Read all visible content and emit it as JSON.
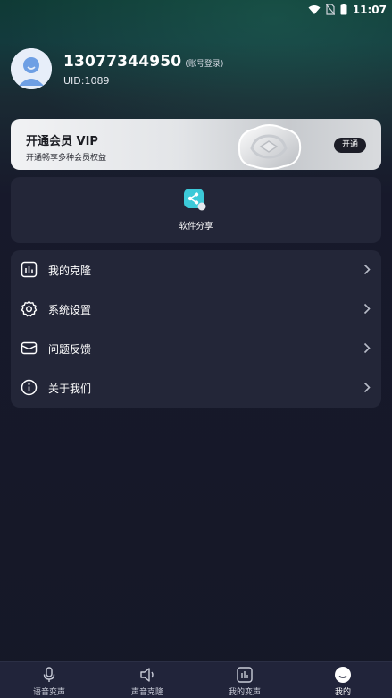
{
  "status_bar": {
    "time": "11:07",
    "icons": [
      "wifi-icon",
      "no-sim-icon",
      "battery-icon"
    ]
  },
  "profile": {
    "phone": "13077344950",
    "login_type": "(账号登录)",
    "uid": "UID:1089"
  },
  "vip": {
    "title": "开通会员 VIP",
    "subtitle": "开通畅享多种会员权益",
    "button": "开通"
  },
  "share": {
    "label": "软件分享",
    "icon": "share-icon"
  },
  "menu": {
    "items": [
      {
        "label": "我的克隆",
        "icon": "chart-icon"
      },
      {
        "label": "系统设置",
        "icon": "gear-icon"
      },
      {
        "label": "问题反馈",
        "icon": "mail-icon"
      },
      {
        "label": "关于我们",
        "icon": "info-icon"
      }
    ]
  },
  "bottom_nav": {
    "items": [
      {
        "label": "语音变声",
        "icon": "microphone-icon"
      },
      {
        "label": "声音克隆",
        "icon": "speaker-icon"
      },
      {
        "label": "我的变声",
        "icon": "equalizer-icon"
      },
      {
        "label": "我的",
        "icon": "profile-icon"
      }
    ],
    "active_index": 3
  },
  "colors": {
    "background": "#171a2b",
    "card": "#232638",
    "accent": "#3cc9d8"
  }
}
